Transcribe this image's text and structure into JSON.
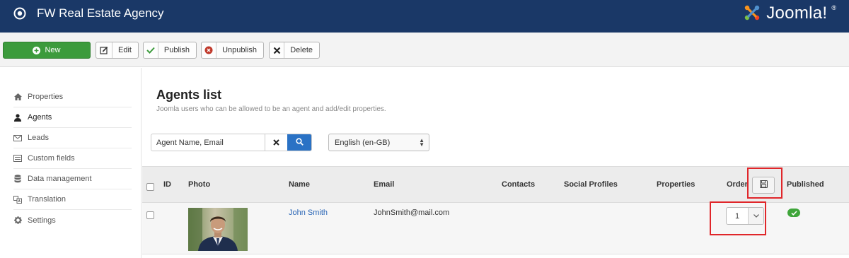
{
  "header": {
    "title": "FW Real Estate Agency",
    "logo_text": "Joomla!",
    "logo_reg": "®",
    "brand_color": "#1a3867"
  },
  "toolbar": {
    "new_label": "New",
    "edit_label": "Edit",
    "publish_label": "Publish",
    "unpublish_label": "Unpublish",
    "delete_label": "Delete"
  },
  "sidebar": {
    "items": [
      {
        "label": "Properties",
        "icon": "home-icon"
      },
      {
        "label": "Agents",
        "icon": "user-icon",
        "active": true
      },
      {
        "label": "Leads",
        "icon": "envelope-icon"
      },
      {
        "label": "Custom fields",
        "icon": "list-icon"
      },
      {
        "label": "Data management",
        "icon": "database-icon"
      },
      {
        "label": "Translation",
        "icon": "translate-icon"
      },
      {
        "label": "Settings",
        "icon": "gear-icon"
      }
    ]
  },
  "main": {
    "title": "Agents list",
    "subtitle": "Joomla users who can be allowed to be an agent and add/edit properties.",
    "search": {
      "placeholder": "Agent Name, Email",
      "value": ""
    },
    "language": {
      "selected": "English (en-GB)"
    }
  },
  "table": {
    "columns": {
      "id": "ID",
      "photo": "Photo",
      "name": "Name",
      "email": "Email",
      "contacts": "Contacts",
      "social": "Social Profiles",
      "properties": "Properties",
      "order": "Order",
      "published": "Published"
    },
    "rows": [
      {
        "id": "",
        "name": "John Smith",
        "email": "JohnSmith@mail.com",
        "contacts": "",
        "social": "",
        "properties": "",
        "order": "1",
        "published": true
      }
    ]
  },
  "colors": {
    "accent": "#2a72c5",
    "success": "#3c9b3c",
    "highlight": "#e0262a"
  }
}
